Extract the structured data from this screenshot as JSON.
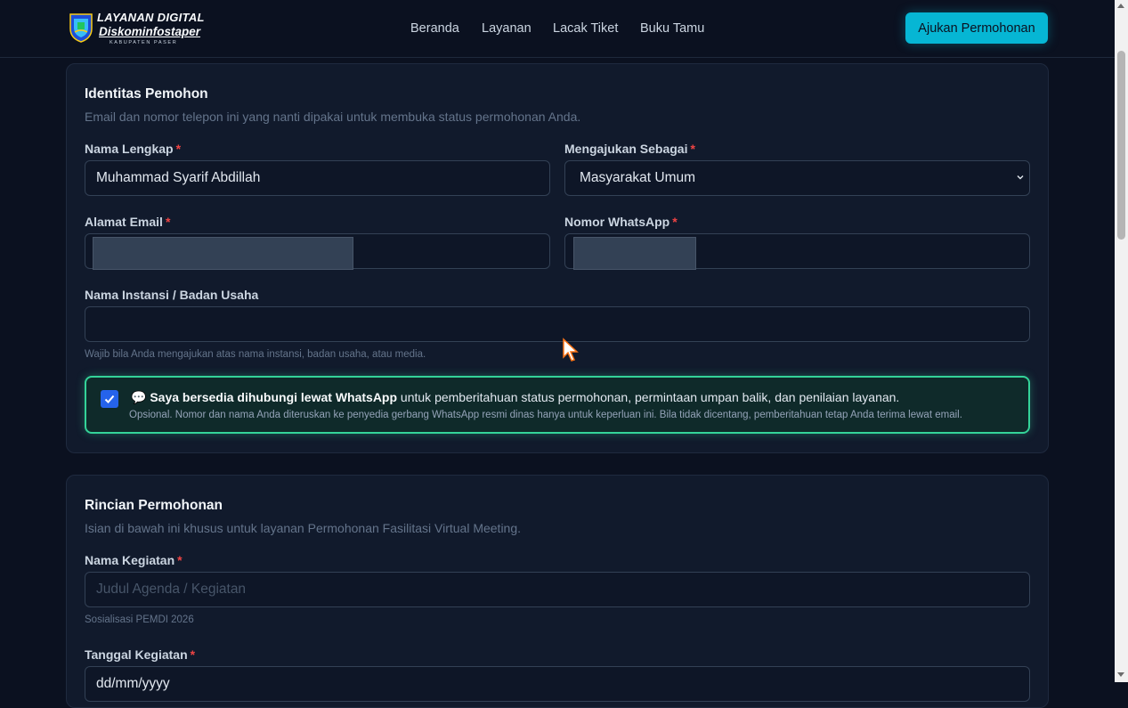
{
  "header": {
    "logo": {
      "line1": "LAYANAN DIGITAL",
      "line2": "Diskominfostaper",
      "line3": "KABUPATEN PASER"
    },
    "nav": [
      "Beranda",
      "Layanan",
      "Lacak Tiket",
      "Buku Tamu"
    ],
    "cta_label": "Ajukan Permohonan"
  },
  "identitas": {
    "title": "Identitas Pemohon",
    "description": "Email dan nomor telepon ini yang nanti dipakai untuk membuka status permohonan Anda.",
    "nama_lengkap": {
      "label": "Nama Lengkap",
      "required": "*",
      "value": "Muhammad Syarif Abdillah"
    },
    "mengajukan_sebagai": {
      "label": "Mengajukan Sebagai",
      "required": "*",
      "value": "Masyarakat Umum"
    },
    "alamat_email": {
      "label": "Alamat Email",
      "required": "*"
    },
    "nomor_whatsapp": {
      "label": "Nomor WhatsApp",
      "required": "*"
    },
    "nama_instansi": {
      "label": "Nama Instansi / Badan Usaha",
      "hint": "Wajib bila Anda mengajukan atas nama instansi, badan usaha, atau media."
    },
    "whatsapp_consent": {
      "checked": true,
      "emoji": "💬",
      "bold_text": "Saya bersedia dihubungi lewat WhatsApp",
      "rest_text": " untuk pemberitahuan status permohonan, permintaan umpan balik, dan penilaian layanan.",
      "note": "Opsional. Nomor dan nama Anda diteruskan ke penyedia gerbang WhatsApp resmi dinas hanya untuk keperluan ini. Bila tidak dicentang, pemberitahuan tetap Anda terima lewat email."
    }
  },
  "rincian": {
    "title": "Rincian Permohonan",
    "description": "Isian di bawah ini khusus untuk layanan Permohonan Fasilitasi Virtual Meeting.",
    "nama_kegiatan": {
      "label": "Nama Kegiatan",
      "required": "*",
      "placeholder": "Judul Agenda / Kegiatan",
      "hint": "Sosialisasi PEMDI 2026"
    },
    "tanggal_kegiatan": {
      "label": "Tanggal Kegiatan",
      "required": "*",
      "placeholder": "dd/mm/yyyy"
    }
  },
  "colors": {
    "accent": "#06b6d4",
    "success_border": "#34d399",
    "required": "#ef4444",
    "background": "#0b1120"
  }
}
